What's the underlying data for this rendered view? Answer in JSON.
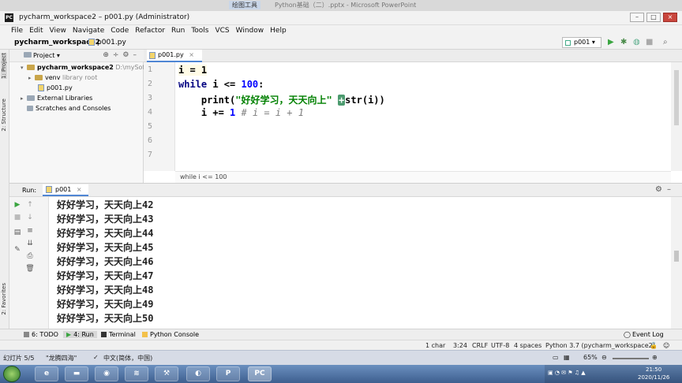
{
  "ppt": {
    "tool_tab": "绘图工具",
    "title": "Python基础（二）.pptx - Microsoft PowerPoint",
    "slide_info": "幻灯片 5/5",
    "theme": "\"龙腾四海\"",
    "lang": "中文(简体，中国)",
    "zoom": "65%"
  },
  "window": {
    "title": "pycharm_workspace2 – p001.py (Administrator)",
    "app_icon": "PC"
  },
  "menu": [
    "File",
    "Edit",
    "View",
    "Navigate",
    "Code",
    "Refactor",
    "Run",
    "Tools",
    "VCS",
    "Window",
    "Help"
  ],
  "navbar": {
    "project": "pycharm_workspace2",
    "file": "p001.py",
    "run_config": "p001"
  },
  "stripe": {
    "project": "1: Project",
    "structure": "2: Structure",
    "favorites": "2: Favorites"
  },
  "project_panel": {
    "title": "Project",
    "root_name": "pycharm_workspace2",
    "root_path": "D:\\mySoftwa",
    "venv": "venv",
    "venv_note": "library root",
    "file": "p001.py",
    "external": "External Libraries",
    "scratches": "Scratches and Consoles"
  },
  "editor": {
    "tab": "p001.py",
    "line_numbers": [
      "1",
      "2",
      "3",
      "4",
      "5",
      "6",
      "7"
    ],
    "code": {
      "l1": "i = 1",
      "l2_kw": "while",
      "l2_rest": " i <= ",
      "l2_num": "100",
      "l2_end": ":",
      "l3_fn": "    print(",
      "l3_str": "\"好好学习，天天向上\"",
      "l3_sp": " ",
      "l3_op": "+",
      "l3_end": "str(i))",
      "l4_a": "    i += ",
      "l4_num": "1",
      "l4_cmt": " # i = i + 1"
    },
    "breadcrumb": "while i <= 100"
  },
  "run": {
    "label": "Run:",
    "tab": "p001",
    "output": [
      "好好学习，天天向上42",
      "好好学习，天天向上43",
      "好好学习，天天向上44",
      "好好学习，天天向上45",
      "好好学习，天天向上46",
      "好好学习，天天向上47",
      "好好学习，天天向上48",
      "好好学习，天天向上49",
      "好好学习，天天向上50"
    ]
  },
  "toolwindows": {
    "todo": "6: TODO",
    "run": "4: Run",
    "terminal": "Terminal",
    "console": "Python Console",
    "event_log": "Event Log"
  },
  "status": {
    "chars": "1 char",
    "position": "3:24",
    "line_sep": "CRLF",
    "encoding": "UTF-8",
    "indent": "4 spaces",
    "interpreter": "Python 3.7 (pycharm_workspace2)"
  },
  "taskbar": {
    "time": "21:50",
    "date": "2020/11/26",
    "pycharm_label": "PC"
  },
  "colors": {
    "keyword": "#000080",
    "number": "#0000ff",
    "string": "#008000",
    "comment": "#808080",
    "run_green": "#3aa540",
    "tab_accent": "#4f86d4"
  }
}
